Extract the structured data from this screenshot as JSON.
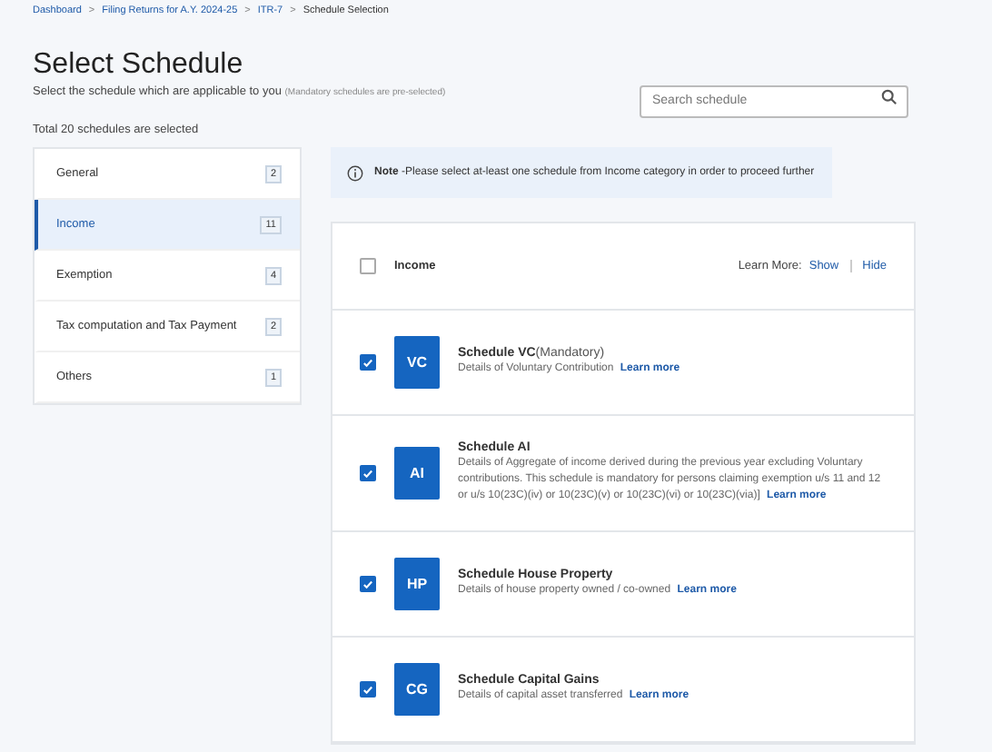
{
  "breadcrumb": [
    {
      "label": "Dashboard",
      "link": true
    },
    {
      "label": "Filing Returns for A.Y. 2024-25",
      "link": true
    },
    {
      "label": "ITR-7",
      "link": true
    },
    {
      "label": "Schedule Selection",
      "link": false
    }
  ],
  "breadcrumb_separator": ">",
  "title": "Select Schedule",
  "subtitle": "Select the schedule which are applicable to you",
  "subtitle_note": "(Mandatory schedules are pre-selected)",
  "search": {
    "placeholder": "Search schedule"
  },
  "total": "Total 20 schedules are selected",
  "categories": [
    {
      "label": "General",
      "count": "2",
      "selected": false
    },
    {
      "label": "Income",
      "count": "11",
      "selected": true
    },
    {
      "label": "Exemption",
      "count": "4",
      "selected": false
    },
    {
      "label": "Tax computation and Tax Payment",
      "count": "2",
      "selected": false
    },
    {
      "label": "Others",
      "count": "1",
      "selected": false
    }
  ],
  "note": {
    "label": "Note",
    "text": "-Please select at-least one schedule from Income category in order to proceed further"
  },
  "group": {
    "title": "Income",
    "checked": false,
    "learn_more_label": "Learn More:",
    "show": "Show",
    "hide": "Hide"
  },
  "schedules": [
    {
      "code": "VC",
      "name": "Schedule VC",
      "suffix": "(Mandatory)",
      "description": "Details of Voluntary Contribution",
      "link": "Learn more",
      "checked": true
    },
    {
      "code": "AI",
      "name": "Schedule AI",
      "description": "Details of Aggregate of income derived during the previous year excluding Voluntary contributions. This schedule is mandatory for persons claiming exemption u/s 11 and 12 or u/s 10(23C)(iv) or 10(23C)(v) or 10(23C)(vi) or 10(23C)(via)]",
      "link": "Learn more",
      "checked": true
    },
    {
      "code": "HP",
      "name": "Schedule House Property",
      "description": "Details of house property owned / co-owned",
      "link": "Learn more",
      "checked": true
    },
    {
      "code": "CG",
      "name": "Schedule Capital Gains",
      "description": "Details of capital asset transferred",
      "link": "Learn more",
      "checked": true
    }
  ]
}
